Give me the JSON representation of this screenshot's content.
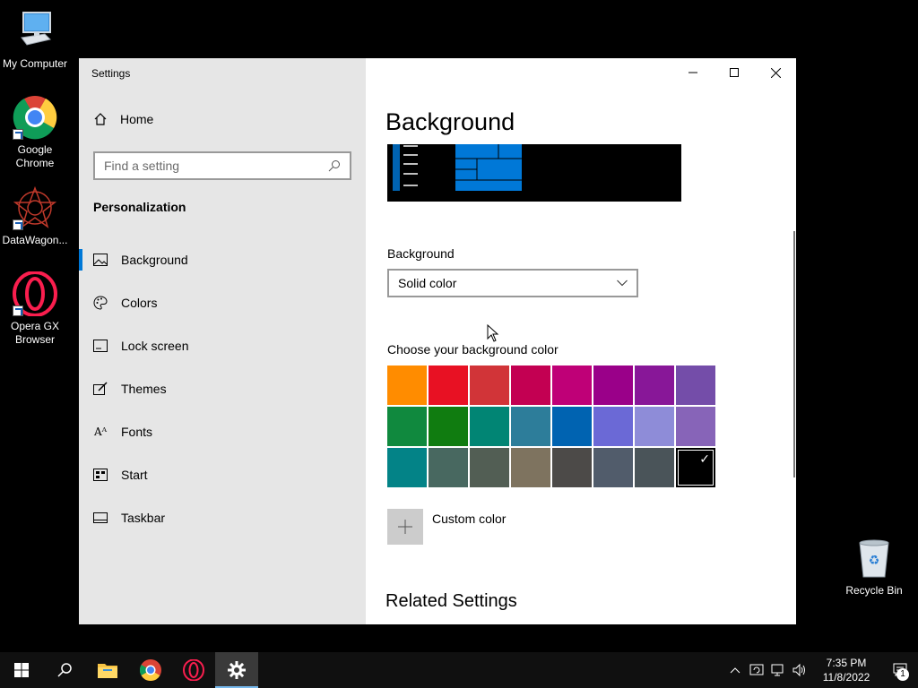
{
  "desktop": {
    "icons": [
      {
        "label": "My Computer",
        "icon": "computer-icon"
      },
      {
        "label": "Google Chrome",
        "icon": "chrome-icon"
      },
      {
        "label": "DataWagon...",
        "icon": "datawagon-icon"
      },
      {
        "label": "Opera GX Browser",
        "icon": "opera-gx-icon"
      }
    ],
    "recycle_bin": "Recycle Bin"
  },
  "window": {
    "title": "Settings",
    "sidebar": {
      "home": "Home",
      "search_placeholder": "Find a setting",
      "section": "Personalization",
      "items": [
        {
          "label": "Background",
          "icon": "picture-icon",
          "active": true
        },
        {
          "label": "Colors",
          "icon": "palette-icon",
          "active": false
        },
        {
          "label": "Lock screen",
          "icon": "lock-screen-icon",
          "active": false
        },
        {
          "label": "Themes",
          "icon": "themes-icon",
          "active": false
        },
        {
          "label": "Fonts",
          "icon": "fonts-icon",
          "active": false
        },
        {
          "label": "Start",
          "icon": "start-icon",
          "active": false
        },
        {
          "label": "Taskbar",
          "icon": "taskbar-icon",
          "active": false
        }
      ]
    },
    "main": {
      "title": "Background",
      "background_label": "Background",
      "background_value": "Solid color",
      "choose_label": "Choose your background color",
      "colors": [
        "#ff8c00",
        "#e81123",
        "#d13438",
        "#c30052",
        "#bf0077",
        "#9a0089",
        "#881798",
        "#744da9",
        "#10893e",
        "#107c10",
        "#018574",
        "#2d7d9a",
        "#0063b1",
        "#6b69d6",
        "#8e8cd8",
        "#8764b8",
        "#038387",
        "#486860",
        "#525e54",
        "#7e735f",
        "#4c4a48",
        "#515c6b",
        "#4a5459",
        "#000000"
      ],
      "selected_color": "#000000",
      "custom_color": "Custom color",
      "related": "Related Settings"
    }
  },
  "taskbar": {
    "time": "7:35 PM",
    "date": "11/8/2022",
    "notification_count": "1",
    "accent": "#76b9ed"
  }
}
